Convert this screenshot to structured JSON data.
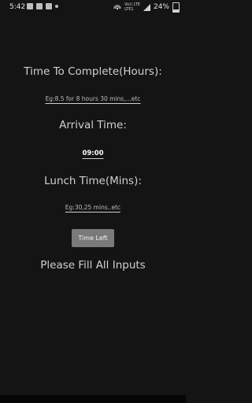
{
  "status_bar": {
    "time": "5:42",
    "network_label_top": "Vo)) LTE",
    "network_label_bottom": "LTE1",
    "battery": "24%"
  },
  "form": {
    "time_to_complete_label": "Time To Complete(Hours):",
    "time_to_complete_placeholder": "Eg:8.5 for 8 hours 30 mins,...etc",
    "arrival_time_label": "Arrival Time:",
    "arrival_time_value": "09:00",
    "lunch_time_label": "Lunch Time(Mins):",
    "lunch_time_placeholder": "Eg:30,25 mins..etc",
    "time_left_button": "Time Left",
    "message": "Please Fill All Inputs"
  }
}
